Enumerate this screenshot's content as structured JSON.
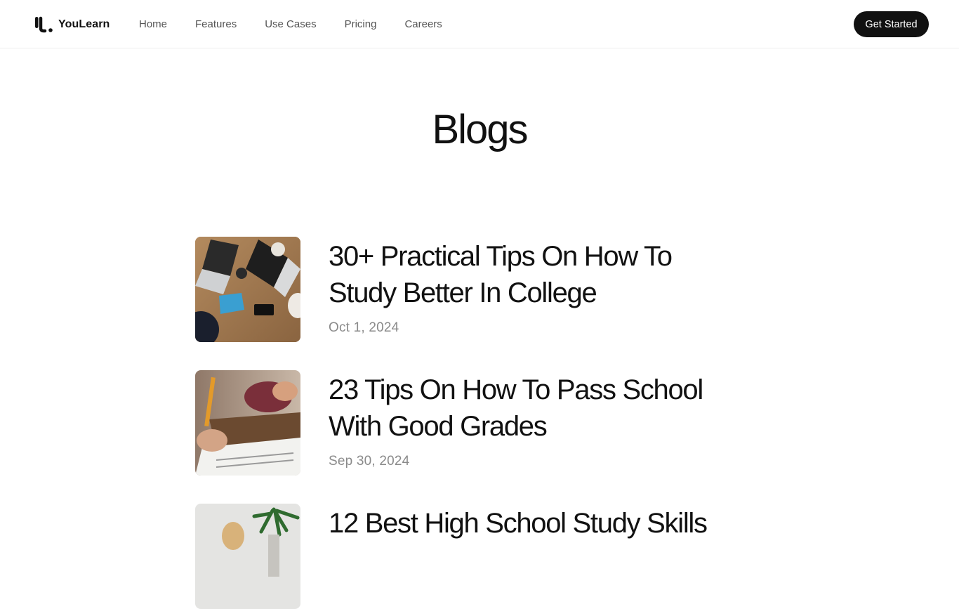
{
  "header": {
    "brand": "YouLearn",
    "nav": [
      {
        "label": "Home"
      },
      {
        "label": "Features"
      },
      {
        "label": "Use Cases"
      },
      {
        "label": "Pricing"
      },
      {
        "label": "Careers"
      }
    ],
    "cta_label": "Get Started"
  },
  "main": {
    "title": "Blogs",
    "posts": [
      {
        "title": "30+ Practical Tips On How To Study Better In College",
        "date": "Oct 1, 2024",
        "image": "students-laptops-on-wooden-table"
      },
      {
        "title": "23 Tips On How To Pass School With Good Grades",
        "date": "Sep 30, 2024",
        "image": "student-writing-exam-at-desk"
      },
      {
        "title": "12 Best High School Study Skills",
        "date": "",
        "image": "student-with-plant"
      }
    ]
  }
}
